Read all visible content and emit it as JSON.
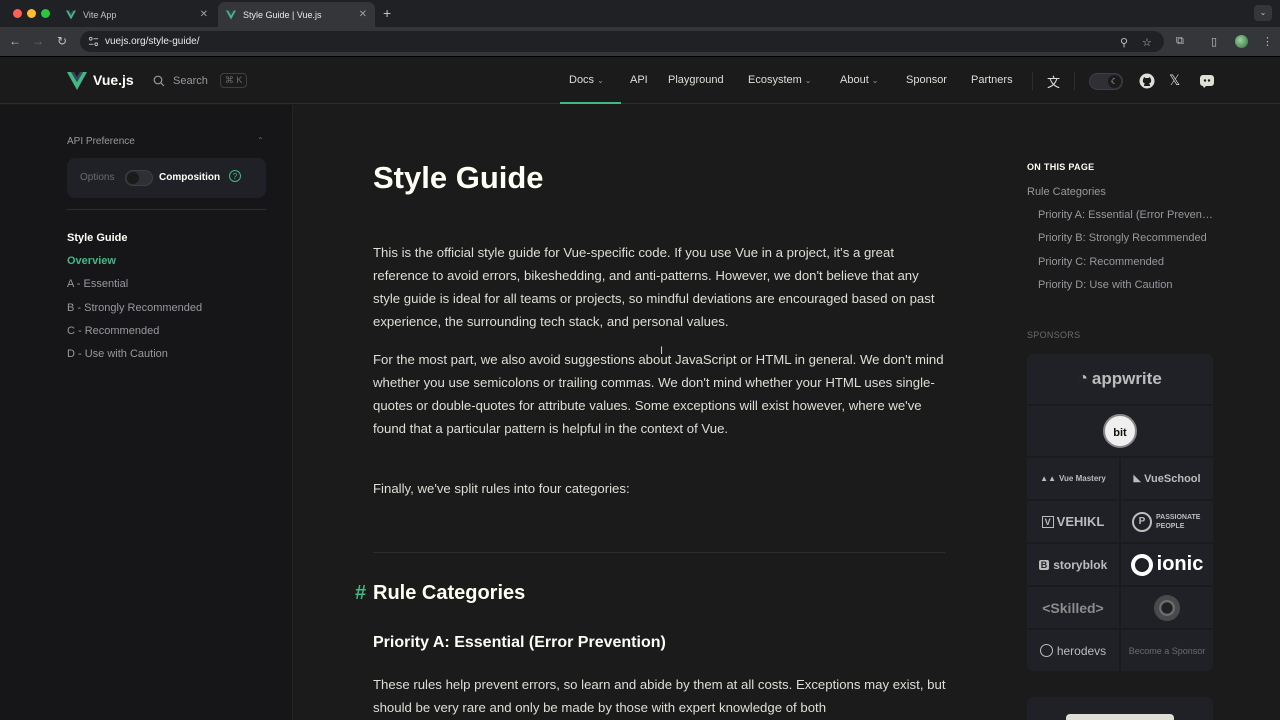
{
  "browser": {
    "tabs": [
      {
        "title": "Vite App",
        "active": false
      },
      {
        "title": "Style Guide | Vue.js",
        "active": true
      }
    ],
    "url": "vuejs.org/style-guide/"
  },
  "nav": {
    "brand": "Vue.js",
    "search_label": "Search",
    "search_shortcut": "⌘ K",
    "menu": [
      {
        "label": "Docs",
        "has_dropdown": true,
        "active": true
      },
      {
        "label": "API",
        "has_dropdown": false
      },
      {
        "label": "Playground",
        "has_dropdown": false
      },
      {
        "label": "Ecosystem",
        "has_dropdown": true
      },
      {
        "label": "About",
        "has_dropdown": true
      },
      {
        "label": "Sponsor",
        "has_dropdown": false
      },
      {
        "label": "Partners",
        "has_dropdown": false
      }
    ]
  },
  "sidebar": {
    "api_preference_label": "API Preference",
    "options_label": "Options",
    "composition_label": "Composition",
    "help_glyph": "?",
    "section_title": "Style Guide",
    "items": [
      {
        "label": "Overview",
        "active": true
      },
      {
        "label": "A - Essential"
      },
      {
        "label": "B - Strongly Recommended"
      },
      {
        "label": "C - Recommended"
      },
      {
        "label": "D - Use with Caution"
      }
    ]
  },
  "content": {
    "title": "Style Guide",
    "paragraphs": [
      "This is the official style guide for Vue-specific code. If you use Vue in a project, it's a great reference to avoid errors, bikeshedding, and anti-patterns. However, we don't believe that any style guide is ideal for all teams or projects, so mindful deviations are encouraged based on past experience, the surrounding tech stack, and personal values.",
      "For the most part, we also avoid suggestions about JavaScript or HTML in general. We don't mind whether you use semicolons or trailing commas. We don't mind whether your HTML uses single-quotes or double-quotes for attribute values. Some exceptions will exist however, where we've found that a particular pattern is helpful in the context of Vue.",
      "Finally, we've split rules into four categories:",
      "These rules help prevent errors, so learn and abide by them at all costs. Exceptions may exist, but should be very rare and only be made by those with expert knowledge of both"
    ],
    "h2_hash": "#",
    "h2": "Rule Categories",
    "h3": "Priority A: Essential (Error Prevention)"
  },
  "aside": {
    "on_this_page": "ON THIS PAGE",
    "toc": [
      {
        "label": "Rule Categories",
        "level": 1
      },
      {
        "label": "Priority A: Essential (Error Prevention)",
        "level": 2
      },
      {
        "label": "Priority B: Strongly Recommended",
        "level": 2
      },
      {
        "label": "Priority C: Recommended",
        "level": 2
      },
      {
        "label": "Priority D: Use with Caution",
        "level": 2
      }
    ],
    "sponsors_label": "SPONSORS",
    "sponsors": [
      "appwrite",
      "bit",
      "Vue Mastery",
      "VueSchool",
      "VEHIKL",
      "PASSIONATE PEOPLE",
      "storyblok",
      "ionic",
      "<Skilled>",
      "herodevs"
    ],
    "become_sponsor": "Become a Sponsor"
  },
  "colors": {
    "accent": "#42b883",
    "background": "#1b1b1b",
    "sidebar_bg": "#161618",
    "text": "#dfdfd6"
  }
}
